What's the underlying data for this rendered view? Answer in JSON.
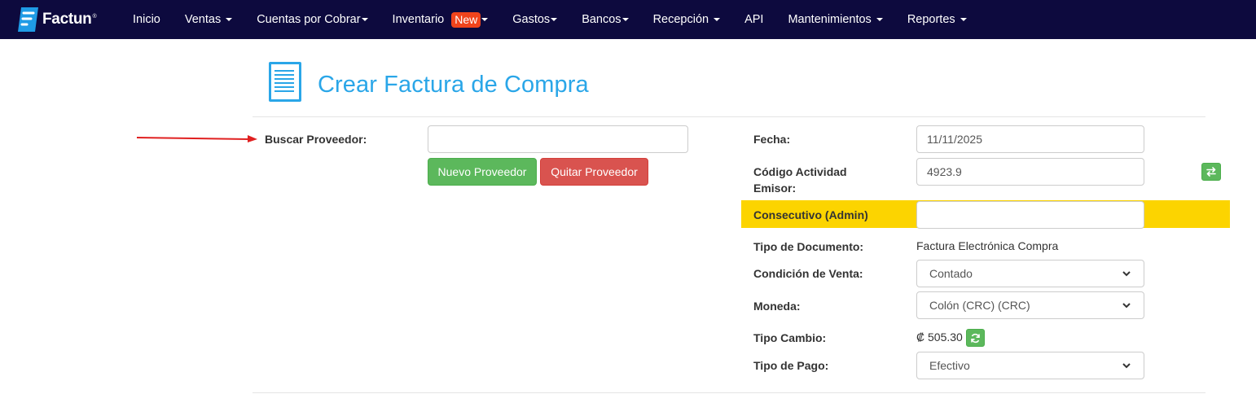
{
  "brand": {
    "name": "Factun",
    "reg": "®"
  },
  "nav": {
    "items": [
      {
        "label": "Inicio",
        "dropdown": false
      },
      {
        "label": "Ventas",
        "dropdown": true
      },
      {
        "label": "Cuentas por Cobrar",
        "dropdown": true
      },
      {
        "label": "Inventario",
        "dropdown": true,
        "badge": "New"
      },
      {
        "label": "Gastos",
        "dropdown": true
      },
      {
        "label": "Bancos",
        "dropdown": true
      },
      {
        "label": "Recepción",
        "dropdown": true
      },
      {
        "label": "API",
        "dropdown": false
      },
      {
        "label": "Mantenimientos",
        "dropdown": true
      },
      {
        "label": "Reportes",
        "dropdown": true
      }
    ]
  },
  "page": {
    "title": "Crear Factura de Compra"
  },
  "left": {
    "buscar_label": "Buscar Proveedor:",
    "buscar_value": "",
    "nuevo_btn": "Nuevo Proveedor",
    "quitar_btn": "Quitar Proveedor"
  },
  "right": {
    "fecha_label": "Fecha:",
    "fecha_value": "11/11/2025",
    "codigo_label_1": "Código Actividad",
    "codigo_label_2": "Emisor:",
    "codigo_value": "4923.9",
    "consecutivo_label": "Consecutivo (Admin)",
    "consecutivo_value": "",
    "tipo_doc_label": "Tipo de Documento:",
    "tipo_doc_value": "Factura Electrónica Compra",
    "condicion_label": "Condición de Venta:",
    "condicion_value": "Contado",
    "moneda_label": "Moneda:",
    "moneda_value": "Colón (CRC) (CRC)",
    "tipo_cambio_label": "Tipo Cambio:",
    "tipo_cambio_value": "₡ 505.30",
    "tipo_pago_label": "Tipo de Pago:",
    "tipo_pago_value": "Efectivo"
  },
  "colors": {
    "navbar": "#0d0a3e",
    "accent": "#2aa6e8",
    "success": "#5cb85c",
    "danger": "#d9534f",
    "highlight": "#fcd400",
    "badge": "#f0441c"
  },
  "icons": [
    "factun-logo-icon",
    "document-list-icon",
    "swap-arrows-icon",
    "refresh-icon",
    "chevron-down-icon",
    "red-arrow-annotation"
  ]
}
